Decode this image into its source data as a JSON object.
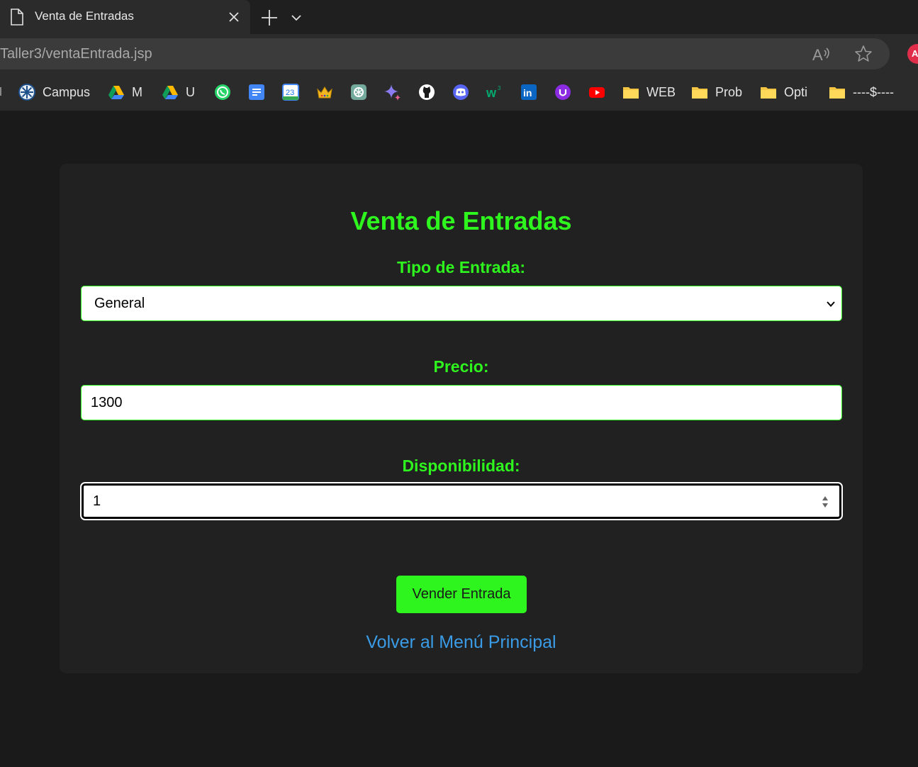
{
  "browser": {
    "tab_title": "Venta de Entradas",
    "url": "Taller3/ventaEntrada.jsp",
    "profile_initial": "A",
    "bookmarks": [
      {
        "label": "Campus",
        "icon": "campus-icon"
      },
      {
        "label": "M",
        "icon": "google-drive-icon"
      },
      {
        "label": "U",
        "icon": "google-drive-icon"
      },
      {
        "label": "",
        "icon": "whatsapp-icon"
      },
      {
        "label": "",
        "icon": "google-docs-icon"
      },
      {
        "label": "",
        "icon": "google-calendar-icon",
        "badge": "23"
      },
      {
        "label": "",
        "icon": "crown-icon"
      },
      {
        "label": "",
        "icon": "chatgpt-icon"
      },
      {
        "label": "",
        "icon": "gemini-icon"
      },
      {
        "label": "",
        "icon": "github-icon"
      },
      {
        "label": "",
        "icon": "discord-icon"
      },
      {
        "label": "",
        "icon": "w3schools-icon"
      },
      {
        "label": "",
        "icon": "linkedin-icon"
      },
      {
        "label": "",
        "icon": "u-app-icon"
      },
      {
        "label": "",
        "icon": "youtube-icon"
      },
      {
        "label": "WEB",
        "icon": "folder-icon"
      },
      {
        "label": "Prob",
        "icon": "folder-icon"
      },
      {
        "label": "Opti",
        "icon": "folder-icon"
      },
      {
        "label": "----$----",
        "icon": "folder-icon"
      }
    ]
  },
  "page": {
    "title": "Venta de Entradas",
    "tipo_label": "Tipo de Entrada:",
    "tipo_value": "General",
    "precio_label": "Precio:",
    "precio_value": "1300",
    "disp_label": "Disponibilidad:",
    "disp_value": "1",
    "submit_label": "Vender Entrada",
    "back_link": "Volver al Menú Principal"
  },
  "colors": {
    "accent_green": "#2ef51e",
    "link_blue": "#3a9be6",
    "page_bg": "#1a1a1a",
    "card_bg": "#212121"
  }
}
